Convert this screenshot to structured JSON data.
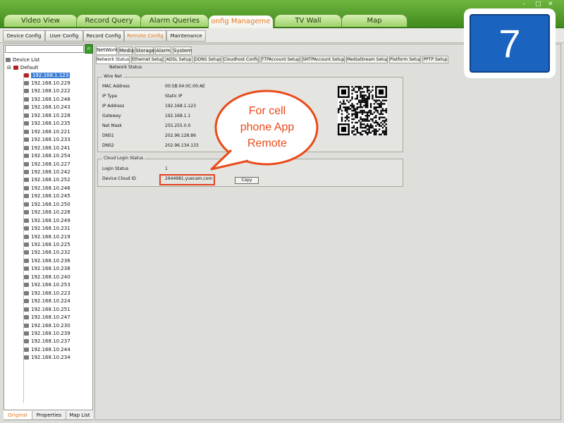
{
  "window_controls": {
    "minimize": "–",
    "maximize": "□",
    "close": "✕"
  },
  "top_tabs": [
    "Video View",
    "Record Query",
    "Alarm Queries",
    "onfig Manageme",
    "TV Wall",
    "Map"
  ],
  "sub_tabs": [
    "Device Config",
    "User Config",
    "Record Config",
    "Remote Config",
    "Maintenance"
  ],
  "search": {
    "value": "",
    "button_icon": "search-icon"
  },
  "tree": {
    "root": "Device List",
    "group": "Default",
    "selected_ip": "192.168.1.123",
    "ips": [
      "192.168.10.229",
      "192.168.10.222",
      "192.168.10.248",
      "192.168.10.243",
      "192.168.10.228",
      "192.168.10.235",
      "192.168.10.221",
      "192.168.10.233",
      "192.168.10.241",
      "192.168.10.254",
      "192.168.10.227",
      "192.168.10.242",
      "192.168.10.252",
      "192.168.10.246",
      "192.168.10.245",
      "192.168.10.250",
      "192.168.10.226",
      "192.168.10.249",
      "192.168.10.231",
      "192.168.10.219",
      "192.168.10.225",
      "192.168.10.232",
      "192.168.10.236",
      "192.168.10.238",
      "192.168.10.240",
      "192.168.10.253",
      "192.168.10.223",
      "192.168.10.224",
      "192.168.10.251",
      "192.168.10.247",
      "192.168.10.230",
      "192.168.10.239",
      "192.168.10.237",
      "192.168.10.244",
      "192.168.10.234"
    ]
  },
  "left_tabs": [
    "Original",
    "Properties",
    "Map List"
  ],
  "config_tabs": [
    "NetWork",
    "Media",
    "Storage",
    "Alarm",
    "System"
  ],
  "network_tabs": [
    "Network Status",
    "Ethernet Setup",
    "ADSL Setup",
    "DDNS Setup",
    "Cloudhost Config",
    "FTPAccount Setup",
    "SMTPAccount Setup",
    "MediaStream Setup",
    "Platform Setup",
    "PPTP Setup"
  ],
  "subcaption": "Network Status",
  "wire_net": {
    "title": "Wire Net",
    "rows": [
      {
        "k": "MAC Address",
        "v": "00:5B:04:0C:00:AE"
      },
      {
        "k": "IP Type",
        "v": "Static IP"
      },
      {
        "k": "IP Address",
        "v": "192.168.1.123"
      },
      {
        "k": "Gateway",
        "v": "192.168.1.1"
      },
      {
        "k": "Net Mask",
        "v": "255.255.0.0"
      },
      {
        "k": "DNS1",
        "v": "202.96.128.86"
      },
      {
        "k": "DNS2",
        "v": "202.96.134.133"
      }
    ]
  },
  "cloud": {
    "title": "Cloud Login Status",
    "login_status_label": "Login Status",
    "login_status_value": "1",
    "device_cloud_id_label": "Device Cloud ID",
    "device_cloud_id_value": "2644981.yuecam.com",
    "copy_label": "Copy"
  },
  "callout": {
    "line1": "For cell",
    "line2": "phone App",
    "line3": "Remote"
  },
  "badge": {
    "number": "7"
  },
  "colors": {
    "accent_orange": "#e2781e",
    "callout_red": "#ea4a1a",
    "badge_blue": "#1a64c0",
    "top_green": "#4f9d2a"
  }
}
